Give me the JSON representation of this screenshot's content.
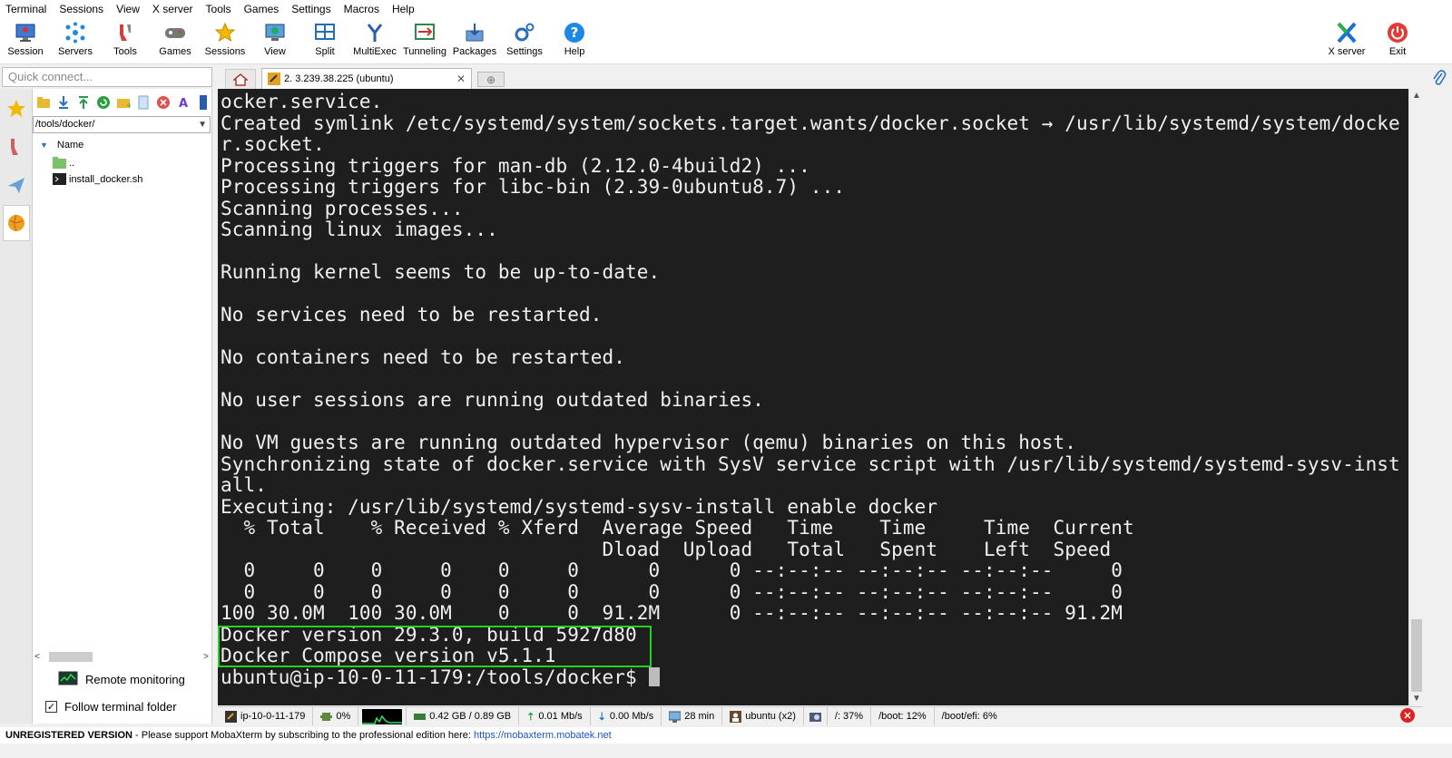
{
  "menu": [
    "Terminal",
    "Sessions",
    "View",
    "X server",
    "Tools",
    "Games",
    "Settings",
    "Macros",
    "Help"
  ],
  "toolbar": {
    "session": "Session",
    "servers": "Servers",
    "tools": "Tools",
    "games": "Games",
    "sessions": "Sessions",
    "view": "View",
    "split": "Split",
    "multiexec": "MultiExec",
    "tunneling": "Tunneling",
    "packages": "Packages",
    "settings": "Settings",
    "help": "Help",
    "xserver": "X server",
    "exit": "Exit"
  },
  "quick_connect": {
    "placeholder": "Quick connect..."
  },
  "tabs": {
    "session_tab": "2. 3.239.38.225 (ubuntu)"
  },
  "file_browser": {
    "path": "/tools/docker/",
    "column_name": "Name",
    "items": [
      "..",
      "install_docker.sh"
    ],
    "remote_monitoring": "Remote monitoring",
    "follow_terminal_folder": "Follow terminal folder",
    "follow_checked": true
  },
  "terminal": {
    "lines": [
      "ocker.service.",
      "Created symlink /etc/systemd/system/sockets.target.wants/docker.socket → /usr/lib/systemd/system/docke",
      "r.socket.",
      "Processing triggers for man-db (2.12.0-4build2) ...",
      "Processing triggers for libc-bin (2.39-0ubuntu8.7) ...",
      "Scanning processes...",
      "Scanning linux images...",
      "",
      "Running kernel seems to be up-to-date.",
      "",
      "No services need to be restarted.",
      "",
      "No containers need to be restarted.",
      "",
      "No user sessions are running outdated binaries.",
      "",
      "No VM guests are running outdated hypervisor (qemu) binaries on this host.",
      "Synchronizing state of docker.service with SysV service script with /usr/lib/systemd/systemd-sysv-inst",
      "all.",
      "Executing: /usr/lib/systemd/systemd-sysv-install enable docker",
      "  % Total    % Received % Xferd  Average Speed   Time    Time     Time  Current",
      "                                 Dload  Upload   Total   Spent    Left  Speed",
      "  0     0    0     0    0     0      0      0 --:--:-- --:--:-- --:--:--     0",
      "  0     0    0     0    0     0      0      0 --:--:-- --:--:-- --:--:--     0",
      "100 30.0M  100 30.0M    0     0  91.2M      0 --:--:-- --:--:-- --:--:-- 91.2M",
      "Docker version 29.3.0, build 5927d80",
      "Docker Compose version v5.1.1"
    ],
    "prompt": "ubuntu@ip-10-0-11-179:/tools/docker$ "
  },
  "statusbar": {
    "host": "ip-10-0-11-179",
    "cpu": "0%",
    "memory": "0.42 GB / 0.89 GB",
    "upload": "0.01 Mb/s",
    "download": "0.00 Mb/s",
    "uptime": "28 min",
    "users": "ubuntu (x2)",
    "disk_root": "/: 37%",
    "disk_boot": "/boot: 12%",
    "disk_boot_efi": "/boot/efi: 6%"
  },
  "bottom": {
    "unregistered": "UNREGISTERED VERSION",
    "message": " -  Please support MobaXterm by subscribing to the professional edition here: ",
    "link": "https://mobaxterm.mobatek.net"
  },
  "colors": {
    "terminal_bg": "#1e1e1e",
    "terminal_fg": "#f0f0f0",
    "highlight": "#1fd31f"
  }
}
